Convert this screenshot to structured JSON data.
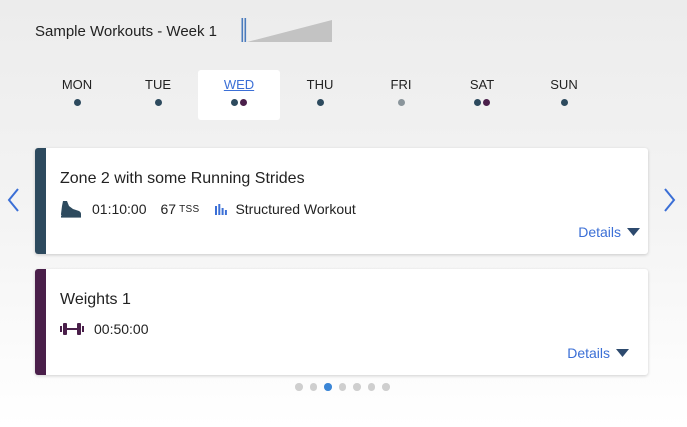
{
  "header": {
    "title": "Sample Workouts - Week 1"
  },
  "days": [
    {
      "label": "MON",
      "dots": [
        "#2d4a5e"
      ],
      "selected": false
    },
    {
      "label": "TUE",
      "dots": [
        "#2d4a5e"
      ],
      "selected": false
    },
    {
      "label": "WED",
      "dots": [
        "#2d4a5e",
        "#4a1f4a"
      ],
      "selected": true
    },
    {
      "label": "THU",
      "dots": [
        "#2d4a5e"
      ],
      "selected": false
    },
    {
      "label": "FRI",
      "dots": [
        "#8a959b"
      ],
      "selected": false
    },
    {
      "label": "SAT",
      "dots": [
        "#2d4a5e",
        "#4a1f4a"
      ],
      "selected": false
    },
    {
      "label": "SUN",
      "dots": [
        "#2d4a5e"
      ],
      "selected": false
    }
  ],
  "workouts": [
    {
      "title": "Zone 2 with some Running Strides",
      "duration": "01:10:00",
      "tss_value": "67",
      "tss_unit": "TSS",
      "type_label": "Structured Workout",
      "details_label": "Details",
      "accent_color": "#2d4a5e",
      "icon": "running-shoe-icon"
    },
    {
      "title": "Weights 1",
      "duration": "00:50:00",
      "details_label": "Details",
      "accent_color": "#4a1f4a",
      "icon": "dumbbell-icon"
    }
  ],
  "pager": {
    "count": 7,
    "active_index": 2
  },
  "colors": {
    "link": "#3b6fd6",
    "arrow": "#3b6fd6",
    "pager_active": "#3b86d6"
  }
}
